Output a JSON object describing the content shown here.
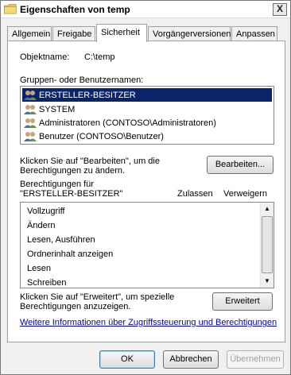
{
  "window": {
    "title": "Eigenschaften von temp",
    "close_glyph": "X"
  },
  "tabs": [
    {
      "label": "Allgemein"
    },
    {
      "label": "Freigabe"
    },
    {
      "label": "Sicherheit"
    },
    {
      "label": "Vorgängerversionen"
    },
    {
      "label": "Anpassen"
    }
  ],
  "object": {
    "label": "Objektname:",
    "value": "C:\\temp"
  },
  "groups": {
    "label": "Gruppen- oder Benutzernamen:",
    "items": [
      {
        "name": "ERSTELLER-BESITZER",
        "icon": "users-icon"
      },
      {
        "name": "SYSTEM",
        "icon": "users-icon"
      },
      {
        "name": "Administratoren (CONTOSO\\Administratoren)",
        "icon": "users-icon"
      },
      {
        "name": "Benutzer (CONTOSO\\Benutzer)",
        "icon": "users-icon"
      }
    ]
  },
  "edit": {
    "hint_line1": "Klicken Sie auf \"Bearbeiten\", um die",
    "hint_line2": "Berechtigungen zu ändern.",
    "button": "Bearbeiten..."
  },
  "permissions": {
    "header_line1": "Berechtigungen für",
    "header_line2": "\"ERSTELLER-BESITZER\"",
    "allow_header": "Zulassen",
    "deny_header": "Verweigern",
    "items": [
      {
        "label": "Vollzugriff"
      },
      {
        "label": "Ändern"
      },
      {
        "label": "Lesen, Ausführen"
      },
      {
        "label": "Ordnerinhalt anzeigen"
      },
      {
        "label": "Lesen"
      },
      {
        "label": "Schreiben"
      }
    ]
  },
  "advanced": {
    "hint_line1": "Klicken Sie auf \"Erweitert\", um spezielle",
    "hint_line2": "Berechtigungen anzuzeigen.",
    "button": "Erweitert"
  },
  "info_link": "Weitere Informationen über Zugriffssteuerung und Berechtigungen",
  "footer": {
    "ok": "OK",
    "cancel": "Abbrechen",
    "apply": "Übernehmen"
  }
}
